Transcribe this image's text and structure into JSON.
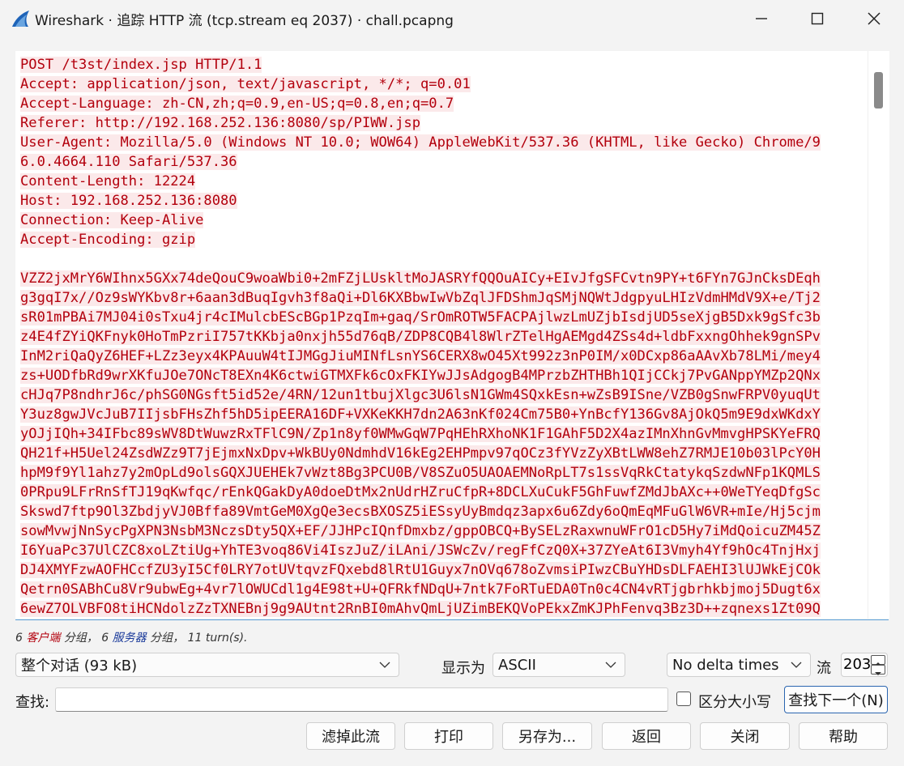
{
  "window": {
    "title": "Wireshark · 追踪 HTTP 流 (tcp.stream eq 2037) · chall.pcapng"
  },
  "stream": {
    "lines": [
      "POST /t3st/index.jsp HTTP/1.1",
      "Accept: application/json, text/javascript, */*; q=0.01",
      "Accept-Language: zh-CN,zh;q=0.9,en-US;q=0.8,en;q=0.7",
      "Referer: http://192.168.252.136:8080/sp/PIWW.jsp",
      "User-Agent: Mozilla/5.0 (Windows NT 10.0; WOW64) AppleWebKit/537.36 (KHTML, like Gecko) Chrome/9",
      "6.0.4664.110 Safari/537.36",
      "Content-Length: 12224",
      "Host: 192.168.252.136:8080",
      "Connection: Keep-Alive",
      "Accept-Encoding: gzip",
      "",
      "VZZ2jxMrY6WIhnx5GXx74deQouC9woaWbi0+2mFZjLUskltMoJASRYfQQOuAICy+EIvJfgSFCvtn9PY+t6FYn7GJnCksDEqh",
      "g3gqI7x//Oz9sWYKbv8r+6aan3dBuqIgvh3f8aQi+Dl6KXBbwIwVbZqlJFDShmJqSMjNQWtJdgpyuLHIzVdmHMdV9X+e/Tj2",
      "sR01mPBAi7MJ04i0sTxu4jr4cIMulcbEScBGp1PzqIm+gaq/SrOmROTW5FACPAjlwzLmUZjbIsdjUD5seXjgB5Dxk9gSfc3b",
      "z4E4fZYiQKFnyk0HoTmPzriI757tKKbja0nxjh55d76qB/ZDP8CQB4l8WlrZTelHgAEMgd4ZSs4d+ldbFxxngOhhek9gnSPv",
      "InM2riQaQyZ6HEF+LZz3eyx4KPAuuW4tIJMGgJiuMINfLsnYS6CERX8wO45Xt992z3nP0IM/x0DCxp86aAAvXb78LMi/mey4",
      "zs+UODfbRd9wrXKfuJOe7ONcT8EXn4K6ctwiGTMXFk6cOxFKIYwJJsAdgogB4MPrzbZHTHBh1QIjCCkj7PvGANppYMZp2QNx",
      "cHJq7P8ndhrJ6c/phSG0NGsft5id52e/4RN/12un1tbujXlgc3U6lsN1GWm4SQxkEsn+wZsB9ISne/VZB0gSnwFRPV0yuqUt",
      "Y3uz8gwJVcJuB7IIjsbFHsZhf5hD5ipEERA16DF+VXKeKKH7dn2A63nKf024Cm75B0+YnBcfY136Gv8AjOkQ5m9E9dxWKdxY",
      "yOJjIQh+34IFbc89sWV8DtWuwzRxTFlC9N/Zp1n8yf0WMwGqW7PqHEhRXhoNK1F1GAhF5D2X4azIMnXhnGvMmvgHPSKYeFRQ",
      "QH21f+H5Uel24ZsdWZz9T7jEjmxNxDpv+WkBUy0NdmhdV16kEg2EHPmpv97qOCz3fYVzZyXBtLWW8ehZ7RMJE10b03lPcY0H",
      "hpM9f9Yl1ahz7y2mOpLd9olsGQXJUEHEk7vWzt8Bg3PCU0B/V8SZuO5UAOAEMNoRpLT7s1ssVqRkCtatykqSzdwNFp1KQMLS",
      "0PRpu9LFrRnSfTJ19qKwfqc/rEnkQGakDyA0doeDtMx2nUdrHZruCfpR+8DCLXuCukF5GhFuwfZMdJbAXc++0WeTYeqDfgSc",
      "Skswd7ftp9Ol3ZbdjyVJ0Bffa89VmtGeM0XgQe3ecsBXOSZ5iESsyUyBmdqz3apx6u6Zdy6oQmEqMFuGlW6VR+mIe/Hj5cjm",
      "sowMvwjNnSycPgXPN3NsbM3NczsDty5QX+EF/JJHPcIQnfDmxbz/gppOBCQ+BySELzRaxwnuWFrO1cD5Hy7iMdQoicuZM45Z",
      "I6YuaPc37UlCZC8xoLZtiUg+YhTE3voq86Vi4IszJuZ/iLAni/JSWcZv/regFfCzQ0X+37ZYeAt6I3Vmyh4Yf9hOc4TnjHxj",
      "DJ4XMYFzwAOFHCcfZU3yI5Cf0LRY7otUVtqvzFQxebd8lRtU1Guyx7nOVq678oZvmsiPIwzCBuYHDsDLFAEHI3lUJWkEjCOk",
      "Qetrn0SABhCu8Vr9ubwEg+4vr7lOWUCdl1g4E98t+U+QFRkfNDqU+7ntk7FoRTuEDA0Tn0c4CN4vRTjgbrhkbjmoj5Dugt6x",
      "6ewZ7OLVBFO8tiHCNdolzZzTXNEBnj9g9AUtnt2RnBI0mAhvQmLjUZimBEKQVoPEkxZmKJPhFenvq3Bz3D++zqnexs1Zt09Q"
    ]
  },
  "status": {
    "client_count": "6",
    "client_label": "客户端",
    "mid1": "分组，",
    "server_count": "6",
    "server_label": "服务器",
    "mid2": "分组，",
    "turns": "11 turn(s)."
  },
  "controls": {
    "conversation_select": "整个对话 (93 kB)",
    "show_as_label": "显示为",
    "show_as_select": "ASCII",
    "delta_select": "No delta times",
    "stream_label": "流",
    "stream_value": "203",
    "find_label": "查找:",
    "find_value": "",
    "case_label": "区分大小写",
    "find_next": "查找下一个(N)"
  },
  "buttons": {
    "filter_out": "滤掉此流",
    "print": "打印",
    "save_as": "另存为...",
    "back": "返回",
    "close": "关闭",
    "help": "帮助"
  }
}
